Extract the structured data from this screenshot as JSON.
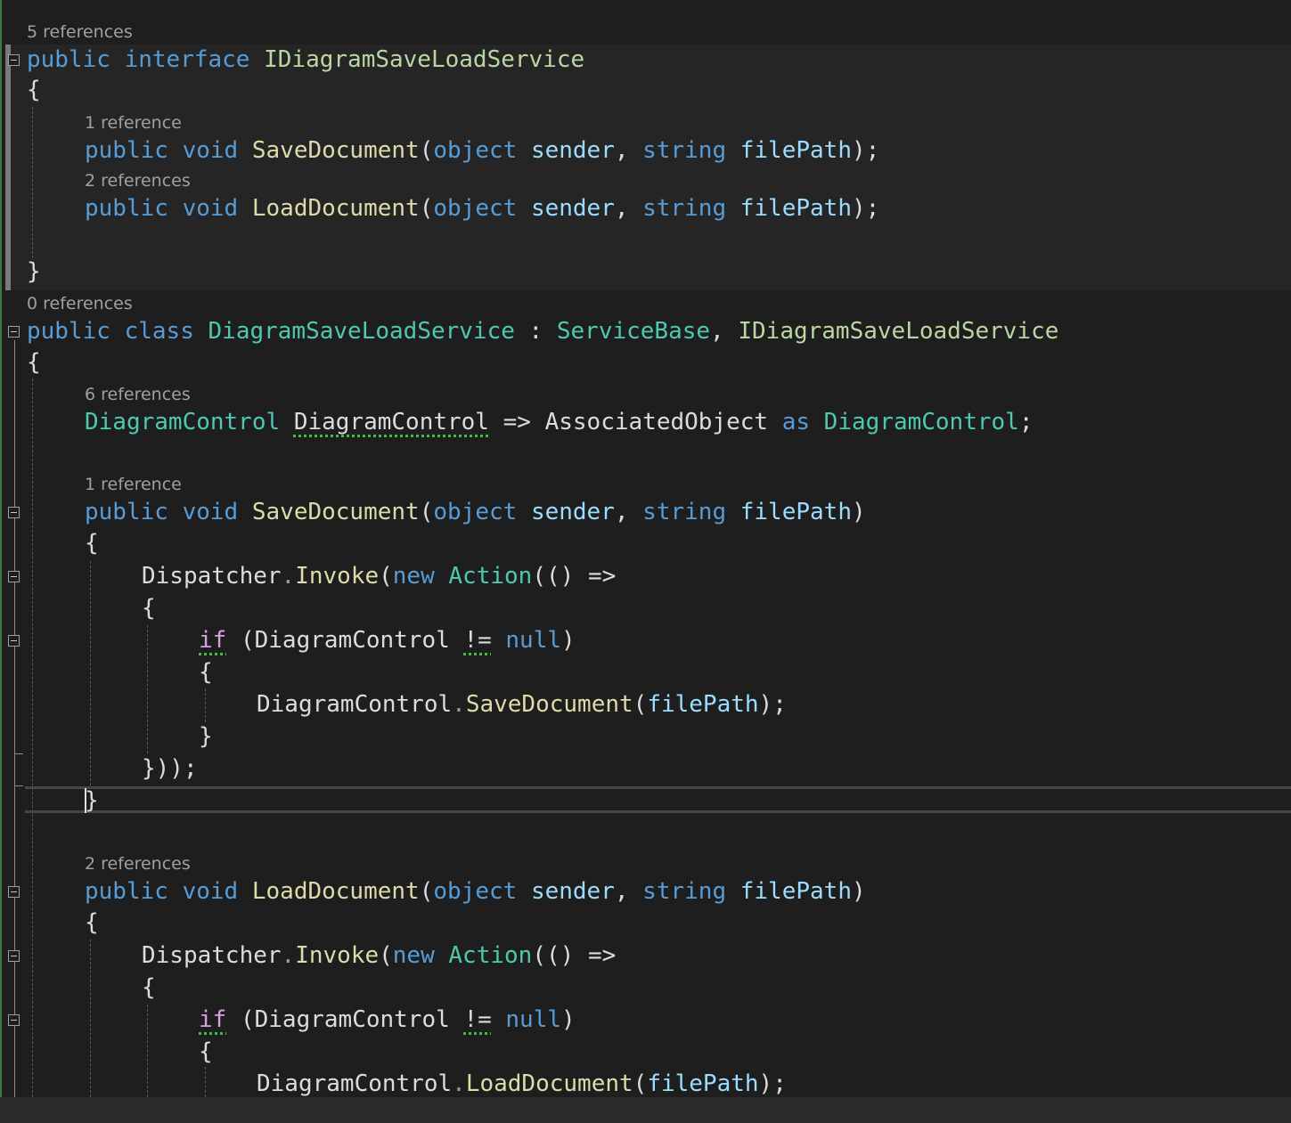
{
  "lenses": {
    "interface_refs": "5 references",
    "save_iface_refs": "1 reference",
    "load_iface_refs": "2 references",
    "class_refs": "0 references",
    "prop_refs": "6 references",
    "save_impl_refs": "1 reference",
    "load_impl_refs": "2 references"
  },
  "code": {
    "kw_public": "public",
    "kw_interface": "interface",
    "kw_class": "class",
    "kw_void": "void",
    "kw_object": "object",
    "kw_string": "string",
    "kw_new": "new",
    "kw_null": "null",
    "kw_as": "as",
    "kw_if": "if",
    "iface_name": "IDiagramSaveLoadService",
    "class_name": "DiagramSaveLoadService",
    "base_class": "ServiceBase",
    "method_save": "SaveDocument",
    "method_load": "LoadDocument",
    "param_sender": "sender",
    "param_filepath": "filePath",
    "type_diagram_control": "DiagramControl",
    "prop_diagram_control": "DiagramControl",
    "associated_object": "AssociatedObject",
    "dispatcher": "Dispatcher",
    "invoke": "Invoke",
    "action": "Action",
    "open_brace": "{",
    "close_brace": "}",
    "lambda_arrow": "=>",
    "not_equal": "!=",
    "close_invoke": "}));",
    "colon": ":"
  },
  "colors": {
    "background": "#1e1e1e",
    "keyword": "#569cd6",
    "type": "#4ec9b0",
    "interface": "#b8d7a3",
    "method": "#dcdcaa",
    "parameter": "#9cdcfe",
    "control_keyword": "#d8a0df",
    "lens": "#a0a0a0"
  }
}
